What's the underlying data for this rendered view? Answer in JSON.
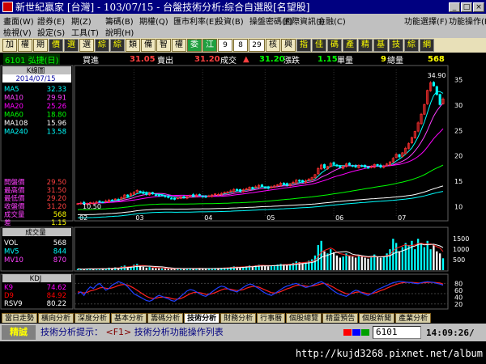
{
  "window": {
    "title": "新世紀贏家 [台灣] - 103/07/15 - 台盤技術分析:綜合自選股[名望股]"
  },
  "menu": {
    "row1": [
      "畫面(W)",
      "證券(E)",
      "期(Z)",
      "籌碼(B)",
      "期權(Q)",
      "匯市利率(E)",
      "投資(B)",
      "操盤密碼(F)",
      "國際資訊(I)",
      "金融(C)"
    ],
    "row1_right": [
      "功能選擇(F)",
      "功能操作(F)"
    ],
    "row2": [
      "檢視(V)",
      "設定(S)",
      "工具(T)",
      "說明(H)"
    ]
  },
  "toolbar": {
    "buttons": [
      "加",
      "權",
      "期",
      "價",
      "選",
      "選",
      "綜",
      "綜",
      "類",
      "備",
      "智",
      "權",
      "委",
      "江",
      "9",
      "8",
      "29",
      "核",
      "興",
      "指",
      "佳",
      "碼",
      "產",
      "精",
      "基",
      "技",
      "綜",
      "網"
    ]
  },
  "quote": {
    "code_name": "6101 弘捷(日)",
    "buy_label": "買進",
    "buy": "31.05",
    "sell_label": "賣出",
    "sell": "31.20",
    "deal_label": "成交",
    "deal": "31.20",
    "change_label": "漲跌",
    "change": "1.15",
    "vol_label": "單量",
    "vol": "9",
    "total_label": "總量",
    "total": "568"
  },
  "indicators": {
    "title": "K線圖",
    "date": "2014/07/15",
    "ma": [
      {
        "label": "MA5",
        "value": "32.33",
        "color": "#00ffff"
      },
      {
        "label": "MA10",
        "value": "29.91",
        "color": "#ff40ff"
      },
      {
        "label": "MA20",
        "value": "25.26",
        "color": "#ff00ff"
      },
      {
        "label": "MA60",
        "value": "18.80",
        "color": "#00ff00"
      },
      {
        "label": "MA108",
        "value": "15.96",
        "color": "#ffffff"
      },
      {
        "label": "MA240",
        "value": "13.58",
        "color": "#00ffff"
      }
    ],
    "prices": [
      {
        "label": "開盤價",
        "value": "29.50"
      },
      {
        "label": "最高價",
        "value": "31.50"
      },
      {
        "label": "最低價",
        "value": "29.20"
      },
      {
        "label": "收盤價",
        "value": "31.20"
      },
      {
        "label": "成交量",
        "value": "568"
      },
      {
        "label": "差",
        "value": "1.15"
      }
    ],
    "vol_title": "成交量",
    "vol": [
      {
        "label": "VOL",
        "value": "568",
        "color": "#ffffff"
      },
      {
        "label": "MV5",
        "value": "844",
        "color": "#00ffff"
      },
      {
        "label": "MV10",
        "value": "870",
        "color": "#ff40ff"
      }
    ],
    "kdj_title": "KDJ",
    "kdj": [
      {
        "label": "K9",
        "value": "74.62",
        "color": "#ff00ff"
      },
      {
        "label": "D9",
        "value": "84.92",
        "color": "#ff0000"
      },
      {
        "label": "RSV9",
        "value": "80.22",
        "color": "#ffffff"
      }
    ]
  },
  "chart_data": {
    "type": "candlestick",
    "price_axis": [
      "35",
      "30",
      "25",
      "20",
      "15",
      "10"
    ],
    "price_range": [
      8,
      37
    ],
    "max_label": "34.90",
    "min_label": "10.50",
    "months": [
      "02",
      "03",
      "04",
      "05",
      "06",
      "07"
    ],
    "volume_axis": [
      "1500",
      "1000",
      "500"
    ],
    "volume_range": [
      0,
      1700
    ],
    "kdj_axis": [
      "80",
      "60",
      "40",
      "20"
    ],
    "kdj_range": [
      10,
      95
    ],
    "closes": [
      10.6,
      10.7,
      10.5,
      10.6,
      10.8,
      10.7,
      10.9,
      11.0,
      10.9,
      11.1,
      11.3,
      11.2,
      11.5,
      11.4,
      11.8,
      12.3,
      12.0,
      12.5,
      12.8,
      13.2,
      12.9,
      12.6,
      12.4,
      12.7,
      12.5,
      12.3,
      12.1,
      12.2,
      12.0,
      11.8,
      11.6,
      11.5,
      11.7,
      11.9,
      11.8,
      12.0,
      12.2,
      12.1,
      12.3,
      12.2,
      12.0,
      11.9,
      12.1,
      12.3,
      12.5,
      12.4,
      12.6,
      12.8,
      12.9,
      13.1,
      13.4,
      13.2,
      13.0,
      13.3,
      13.5,
      13.8,
      13.6,
      13.9,
      14.2,
      14.0,
      13.8,
      13.6,
      13.9,
      14.1,
      14.3,
      14.6,
      14.4,
      14.2,
      14.5,
      14.8,
      15.2,
      15.0,
      14.8,
      15.1,
      15.4,
      15.7,
      16.3,
      17.5,
      18.2,
      17.6,
      17.9,
      18.5,
      18.3,
      18.0,
      17.7,
      17.9,
      18.4,
      18.2,
      18.0,
      17.8,
      18.1,
      18.0,
      17.8,
      17.7,
      17.9,
      18.3,
      18.0,
      17.8,
      18.0,
      18.4,
      18.8,
      19.5,
      20.3,
      19.8,
      20.6,
      21.5,
      22.4,
      23.6,
      24.8,
      26.5,
      28.2,
      30.1,
      32.9,
      34.4,
      33.8,
      32.1,
      30.1,
      31.2
    ],
    "volumes": [
      60,
      50,
      45,
      70,
      80,
      60,
      55,
      70,
      90,
      80,
      120,
      100,
      140,
      110,
      180,
      220,
      150,
      190,
      260,
      300,
      200,
      160,
      120,
      150,
      110,
      100,
      90,
      100,
      80,
      70,
      60,
      55,
      65,
      80,
      70,
      85,
      90,
      75,
      95,
      80,
      70,
      60,
      75,
      90,
      100,
      95,
      110,
      120,
      130,
      150,
      180,
      160,
      140,
      170,
      190,
      220,
      200,
      230,
      260,
      240,
      200,
      180,
      210,
      240,
      270,
      300,
      280,
      260,
      300,
      350,
      420,
      380,
      340,
      380,
      450,
      520,
      700,
      1200,
      1400,
      900,
      800,
      1000,
      850,
      700,
      600,
      650,
      800,
      700,
      650,
      600,
      700,
      650,
      600,
      550,
      650,
      750,
      650,
      600,
      650,
      800,
      1000,
      1500,
      1300,
      900,
      1100,
      1300,
      1200,
      1400,
      1000,
      1500,
      1300,
      1100,
      1400,
      1000,
      1200,
      900,
      800,
      568
    ],
    "kdj_k": [
      50,
      55,
      45,
      60,
      70,
      65,
      75,
      80,
      70,
      60,
      65,
      75,
      80,
      85,
      82,
      78,
      70,
      60,
      50,
      45,
      40,
      35,
      30,
      28,
      32,
      40,
      45,
      42,
      38,
      35,
      30,
      28,
      34,
      42,
      50,
      58,
      62,
      60,
      55,
      50,
      45,
      42,
      48,
      55,
      62,
      68,
      72,
      70,
      65,
      60,
      58,
      55,
      62,
      68,
      74,
      78,
      76,
      70,
      65,
      58,
      52,
      48,
      45,
      50,
      56,
      62,
      68,
      72,
      75,
      78,
      80,
      76,
      72,
      68,
      70,
      74,
      78,
      82,
      85,
      80,
      72,
      65,
      58,
      52,
      48,
      45,
      42,
      48,
      55,
      60,
      58,
      52,
      48,
      45,
      50,
      56,
      62,
      66,
      70,
      74,
      78,
      82,
      84,
      86,
      85,
      84,
      83,
      82,
      80,
      79,
      82,
      84,
      85,
      84,
      83,
      80,
      78,
      75
    ],
    "kdj_d": [
      55,
      54,
      52,
      54,
      58,
      60,
      63,
      67,
      68,
      66,
      65,
      67,
      70,
      74,
      76,
      77,
      75,
      71,
      66,
      60,
      54,
      48,
      42,
      38,
      36,
      37,
      39,
      40,
      40,
      39,
      36,
      34,
      34,
      36,
      40,
      45,
      50,
      53,
      54,
      53,
      51,
      48,
      48,
      50,
      53,
      57,
      61,
      64,
      64,
      63,
      61,
      59,
      60,
      62,
      66,
      69,
      71,
      71,
      69,
      65,
      61,
      57,
      53,
      52,
      53,
      56,
      60,
      64,
      67,
      71,
      74,
      75,
      74,
      72,
      71,
      72,
      74,
      76,
      79,
      80,
      77,
      73,
      68,
      63,
      58,
      54,
      50,
      49,
      51,
      54,
      55,
      54,
      52,
      50,
      50,
      52,
      55,
      59,
      62,
      66,
      70,
      74,
      77,
      80,
      82,
      83,
      83,
      83,
      82,
      81,
      81,
      82,
      83,
      83,
      83,
      82,
      81,
      78
    ]
  },
  "tabs": [
    "當日走勢",
    "橫向分析",
    "深度分析",
    "基本分析",
    "籌碼分析",
    "技術分析",
    "財務分析",
    "行事曆",
    "個股總覽",
    "精靈預告",
    "個股新聞",
    "產業分析"
  ],
  "active_tab": "技術分析",
  "status": {
    "mode": "精誠",
    "hint_label": "技術分析提示：",
    "hint_key": "<F1>",
    "hint_text": "技術分析功能操作列表",
    "code": "6101",
    "time": "14:09:26/"
  },
  "watermark_url": "http://kujd3268.pixnet.net/album"
}
